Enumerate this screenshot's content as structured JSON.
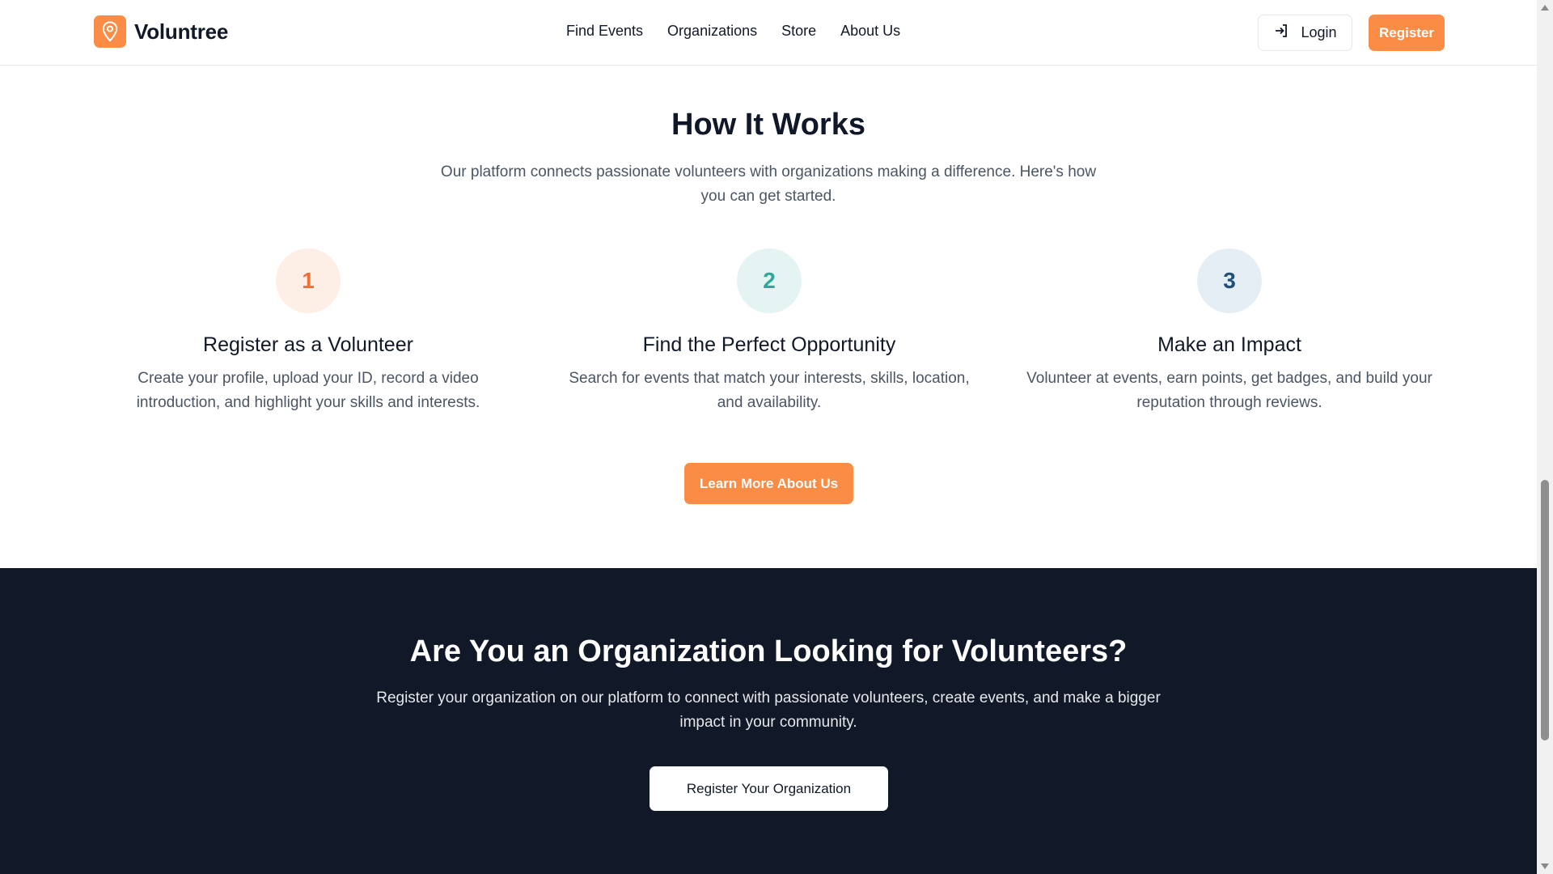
{
  "header": {
    "brand": "Voluntree",
    "nav": [
      "Find Events",
      "Organizations",
      "Store",
      "About Us"
    ],
    "login_label": "Login",
    "register_label": "Register"
  },
  "how": {
    "title": "How It Works",
    "subtitle": "Our platform connects passionate volunteers with organizations making a difference. Here's how you can get started.",
    "steps": [
      {
        "number": "1",
        "title": "Register as a Volunteer",
        "desc": "Create your profile, upload your ID, record a video introduction, and highlight your skills and interests.",
        "circle_bg": "#fdeee6",
        "number_color": "#f26e38"
      },
      {
        "number": "2",
        "title": "Find the Perfect Opportunity",
        "desc": "Search for events that match your interests, skills, location, and availability.",
        "circle_bg": "#e4f4f2",
        "number_color": "#2fa79a"
      },
      {
        "number": "3",
        "title": "Make an Impact",
        "desc": "Volunteer at events, earn points, get badges, and build your reputation through reviews.",
        "circle_bg": "#e6eef5",
        "number_color": "#1f4f7a"
      }
    ],
    "learn_more_label": "Learn More About Us"
  },
  "org": {
    "title": "Are You an Organization Looking for Volunteers?",
    "subtitle": "Register your organization on our platform to connect with passionate volunteers, create events, and make a bigger impact in your community.",
    "button_label": "Register Your Organization"
  },
  "icons": {
    "brand": "map-pin-icon",
    "login": "login-arrow-icon"
  },
  "colors": {
    "accent": "#fb8c45",
    "dark_section": "#111827"
  }
}
